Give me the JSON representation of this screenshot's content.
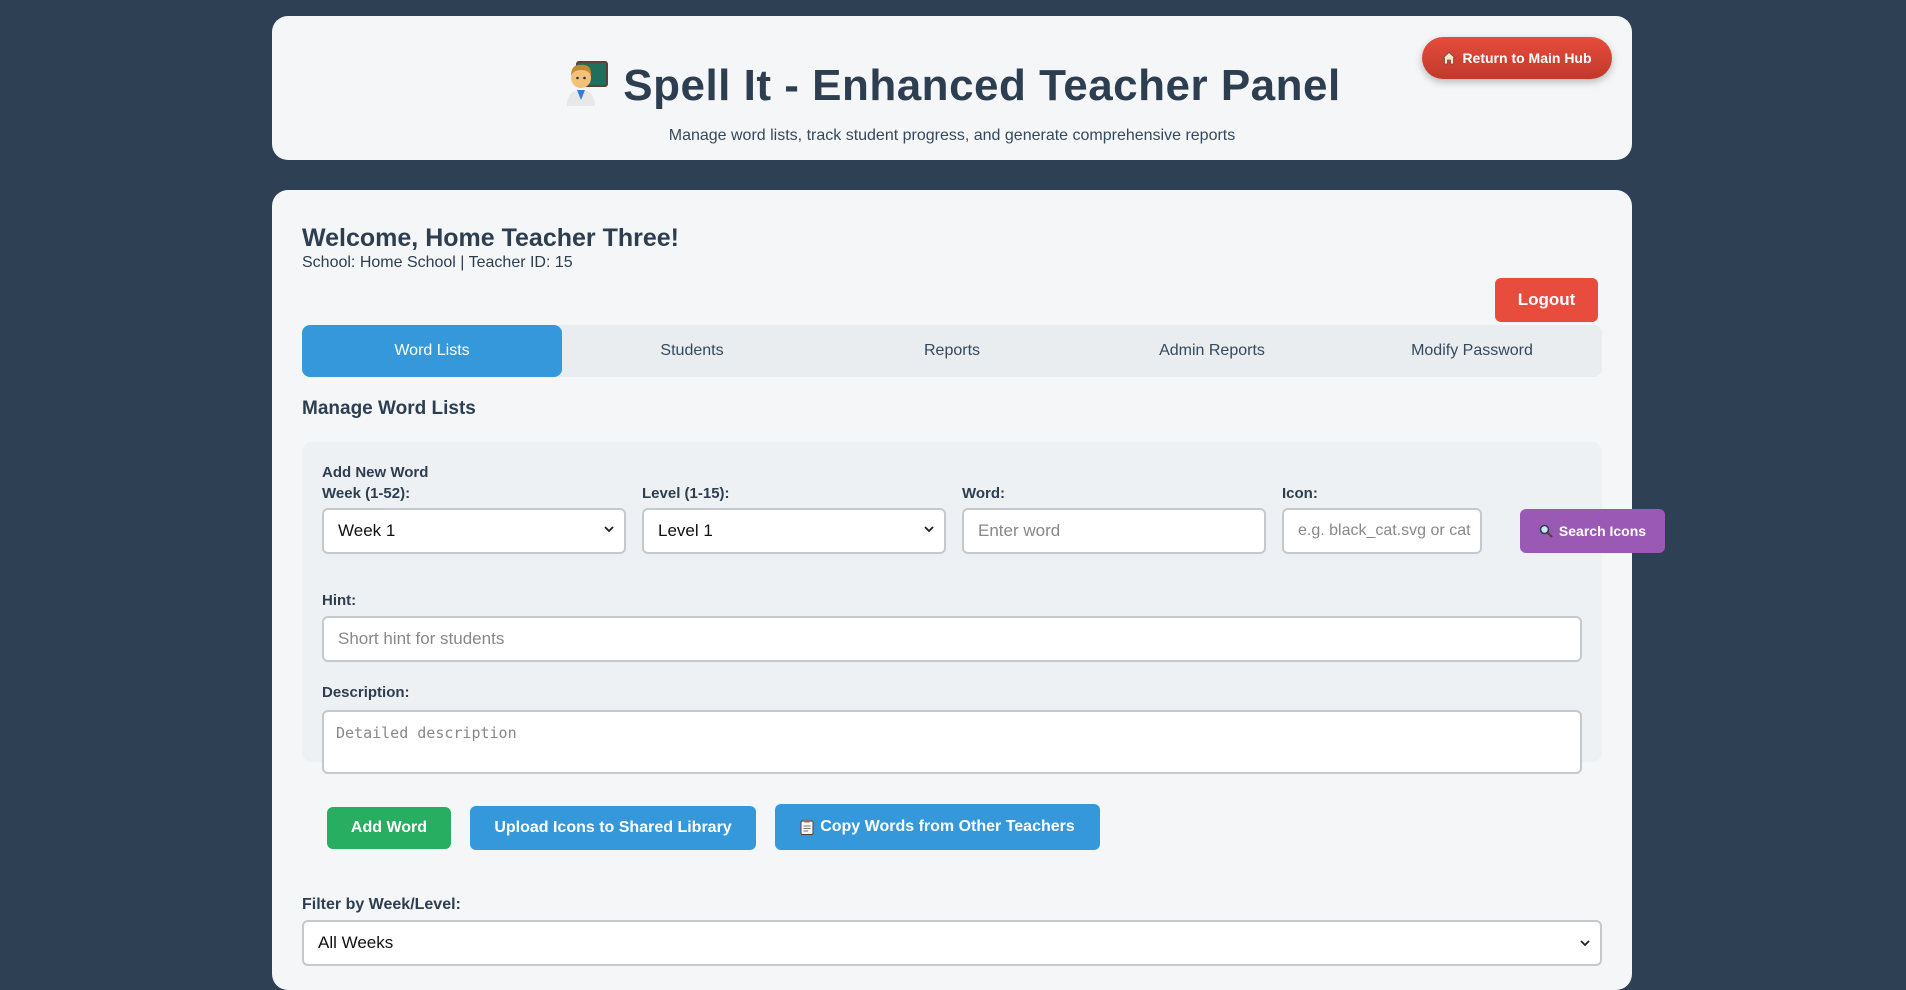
{
  "header": {
    "title": "Spell It - Enhanced Teacher Panel",
    "subtitle": "Manage word lists, track student progress, and generate comprehensive reports",
    "hub_button": "Return to Main Hub"
  },
  "user": {
    "welcome": "Welcome, Home Teacher Three!",
    "info": "School: Home School | Teacher ID: 15",
    "logout": "Logout"
  },
  "tabs": [
    {
      "label": "Word Lists",
      "active": true
    },
    {
      "label": "Students",
      "active": false
    },
    {
      "label": "Reports",
      "active": false
    },
    {
      "label": "Admin Reports",
      "active": false
    },
    {
      "label": "Modify Password",
      "active": false
    }
  ],
  "section_title": "Manage Word Lists",
  "form": {
    "heading": "Add New Word",
    "week_label": "Week (1-52):",
    "week_value": "Week 1",
    "level_label": "Level (1-15):",
    "level_value": "Level 1",
    "word_label": "Word:",
    "word_placeholder": "Enter word",
    "icon_label": "Icon:",
    "icon_placeholder": "e.g. black_cat.svg or cat",
    "search_icons": "Search Icons",
    "hint_label": "Hint:",
    "hint_placeholder": "Short hint for students",
    "description_label": "Description:",
    "description_placeholder": "Detailed description",
    "add_word": "Add Word",
    "upload_icons": "Upload Icons to Shared Library",
    "copy_words": "Copy Words from Other Teachers"
  },
  "filter": {
    "label": "Filter by Week/Level:",
    "value": "All Weeks"
  },
  "colors": {
    "background": "#2e4053",
    "accent_blue": "#3498db",
    "danger_red": "#e74c3c",
    "success_green": "#27ae60",
    "purple": "#9b59b6"
  },
  "icons": {
    "title": "teacher-emoji-icon",
    "hub": "house-icon",
    "search": "magnifier-icon",
    "copy": "clipboard-icon"
  }
}
